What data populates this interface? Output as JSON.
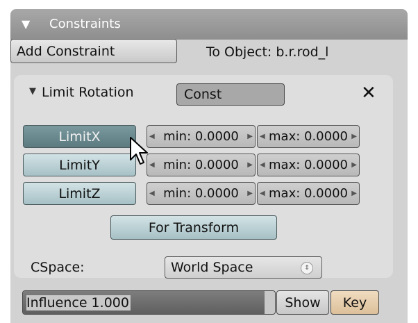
{
  "panel": {
    "title": "Constraints",
    "collapse_icon": "triangle-down-icon"
  },
  "add_constraint": {
    "label": "Add Constraint"
  },
  "to_object": {
    "label": "To Object: b.r.rod_l"
  },
  "constraint": {
    "title": "Limit Rotation",
    "name": "Const",
    "close_icon": "close-x-icon",
    "limits": [
      {
        "label": "LimitX",
        "min": "min: 0.0000",
        "max": "max: 0.0000",
        "active": true
      },
      {
        "label": "LimitY",
        "min": "min: 0.0000",
        "max": "max: 0.0000",
        "active": false
      },
      {
        "label": "LimitZ",
        "min": "min: 0.0000",
        "max": "max: 0.0000",
        "active": false
      }
    ],
    "for_transform": "For Transform",
    "cspace_label": "CSpace:",
    "cspace_value": "World Space"
  },
  "influence": {
    "label": "Influence 1.000",
    "value": 1.0
  },
  "show_label": "Show",
  "key_label": "Key",
  "colors": {
    "active_limit": "#6a8a90",
    "limit_button": "#bcd3d7",
    "key_button": "#e8ccaa"
  }
}
